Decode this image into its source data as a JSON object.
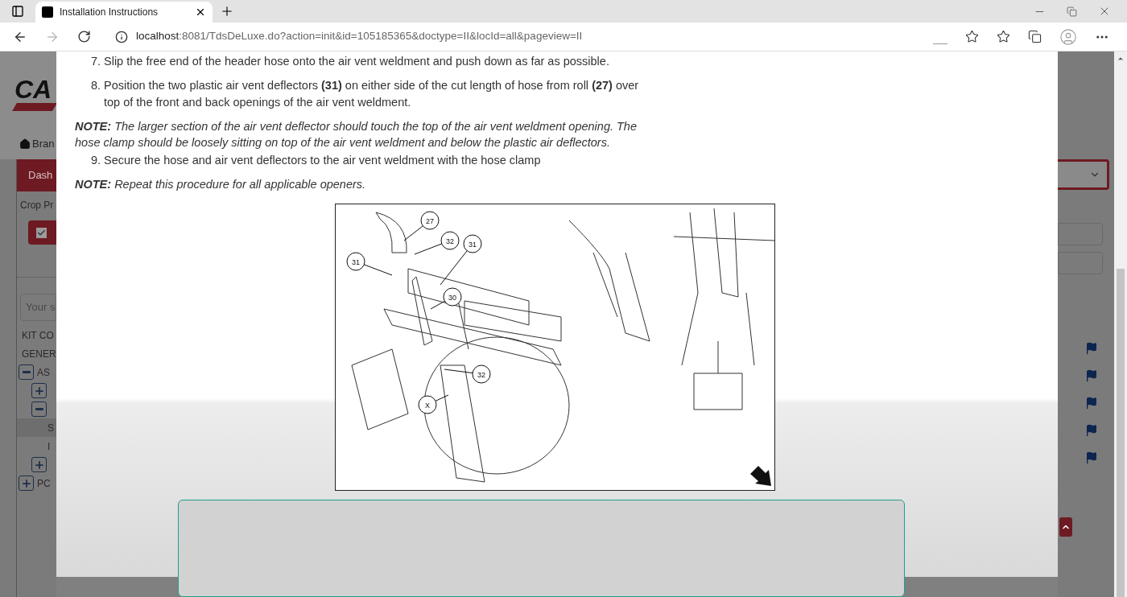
{
  "browser": {
    "tab_title": "Installation Instructions",
    "url_host": "localhost",
    "url_rest": ":8081/TdsDeLuxe.do?action=init&id=105185365&doctype=II&locId=all&pageview=II"
  },
  "background_page": {
    "logo_text": "CA",
    "breadcrumb": "Bran",
    "dashboard_tab": "Dash",
    "crop_label": "Crop Pr",
    "filter_checkbox": {
      "checked": true
    },
    "search": {
      "placeholder": "Your s"
    },
    "tree": [
      {
        "label": "KIT CO",
        "selected": false
      },
      {
        "label": "GENER",
        "selected": false
      },
      {
        "label": "AS",
        "expanded": true,
        "selected": false,
        "children": [
          {
            "expanded": false,
            "selected": false
          },
          {
            "expanded": true,
            "selected": false,
            "children": [
              {
                "label": "S",
                "selected": true
              },
              {
                "label": "I",
                "selected": false
              }
            ]
          },
          {
            "expanded": false,
            "selected": false
          }
        ]
      },
      {
        "label": "PC",
        "expanded": false,
        "selected": false
      }
    ]
  },
  "modal": {
    "items": [
      {
        "kind": "step",
        "number": "7.",
        "text": "Slip the free end of the header hose onto the air vent weldment and push down as far as possible."
      },
      {
        "kind": "step",
        "number": "8.",
        "text": "Position the two plastic air vent deflectors **(31)** on either side of the cut length of hose from roll **(27)** over top of the front and back openings of the air vent weldment."
      },
      {
        "kind": "note",
        "label": "NOTE:",
        "text": "The larger section of the air vent deflector should touch the top of the air vent weldment opening. The hose clamp should be loosely sitting on top of the air vent weldment and below the plastic air deflectors."
      },
      {
        "kind": "step",
        "number": "9.",
        "text": "Secure the hose and air vent deflectors to the air vent weldment with the hose clamp"
      },
      {
        "kind": "note",
        "label": "NOTE:",
        "text": "Repeat this procedure for all applicable openers."
      }
    ],
    "figure": {
      "callouts": [
        "27",
        "32",
        "31",
        "31",
        "30",
        "32",
        "X"
      ]
    }
  }
}
